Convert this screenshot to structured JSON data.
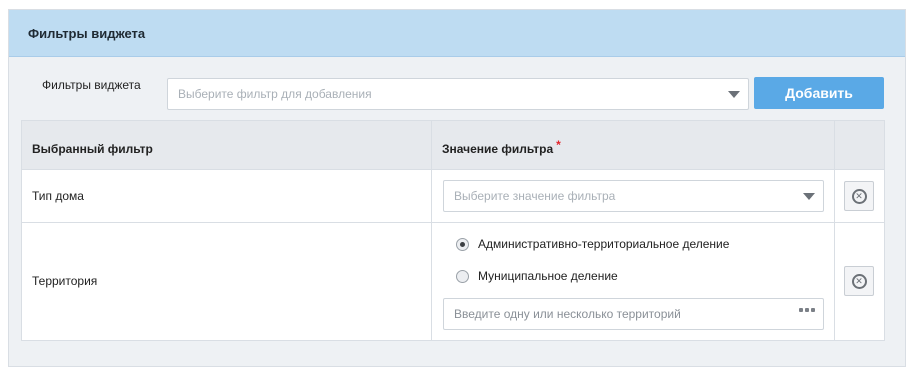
{
  "panel": {
    "title": "Фильтры виджета",
    "filter_label": "Фильтры виджета",
    "filter_select_placeholder": "Выберите фильтр для добавления",
    "add_button": "Добавить"
  },
  "table": {
    "headers": {
      "filter": "Выбранный фильтр",
      "value": "Значение фильтра",
      "required_mark": "*"
    },
    "rows": [
      {
        "name": "Тип дома",
        "value_placeholder": "Выберите значение фильтра"
      },
      {
        "name": "Территория",
        "radio_options": [
          {
            "label": "Административно-территориальное деление",
            "checked": true
          },
          {
            "label": "Муниципальное деление",
            "checked": false
          }
        ],
        "input_placeholder": "Введите одну или несколько территорий"
      }
    ]
  },
  "icons": {
    "select_caret": "chevron-down-icon",
    "remove": "close-circle-icon",
    "more": "ellipsis-icon"
  },
  "colors": {
    "header_bg": "#bedcf2",
    "button_bg": "#5aa9e6",
    "required": "#e2262c"
  }
}
